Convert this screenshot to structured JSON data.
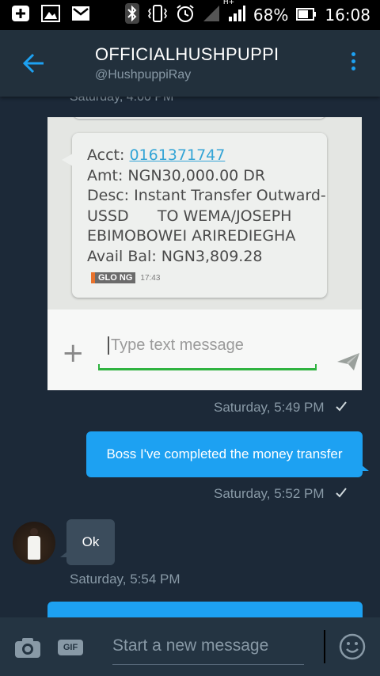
{
  "status_bar": {
    "icons": [
      "add-notification-icon",
      "image-icon",
      "mail-icon",
      "bluetooth-icon",
      "vibrate-icon",
      "alarm-icon",
      "signal-icon",
      "data-signal-icon",
      "battery-icon"
    ],
    "network_label": "H+",
    "battery": "68%",
    "time": "16:08"
  },
  "header": {
    "title": "OFFICIALHUSHPUPPI",
    "handle": "@HushpuppiRay"
  },
  "chat": {
    "partial_timestamp": "Saturday, 4:00 PM",
    "screenshot": {
      "sms_acct_label": "Acct: ",
      "sms_acct_number": "0161371747",
      "sms_body": "Amt: NGN30,000.00 DR\nDesc: Instant Transfer Outward-\nUSSD      TO WEMA/JOSEPH\nEBIMOBOWEI ARIREDIEGHA\nAvail Bal: NGN3,809.28",
      "carrier": "GLO NG",
      "sms_time": "17:43",
      "composer_placeholder": "Type text message"
    },
    "messages": [
      {
        "timestamp": "Saturday, 5:49 PM"
      },
      {
        "text": "Boss I've completed the money transfer",
        "timestamp": "Saturday, 5:52 PM"
      },
      {
        "text": "Ok",
        "timestamp": "Saturday, 5:54 PM"
      }
    ]
  },
  "bottom_bar": {
    "gif_label": "GIF",
    "placeholder": "Start a new message"
  },
  "colors": {
    "accent": "#1da1f2",
    "background": "#1c2938",
    "header": "#22303c",
    "incoming_bubble": "#3b4c5c"
  }
}
